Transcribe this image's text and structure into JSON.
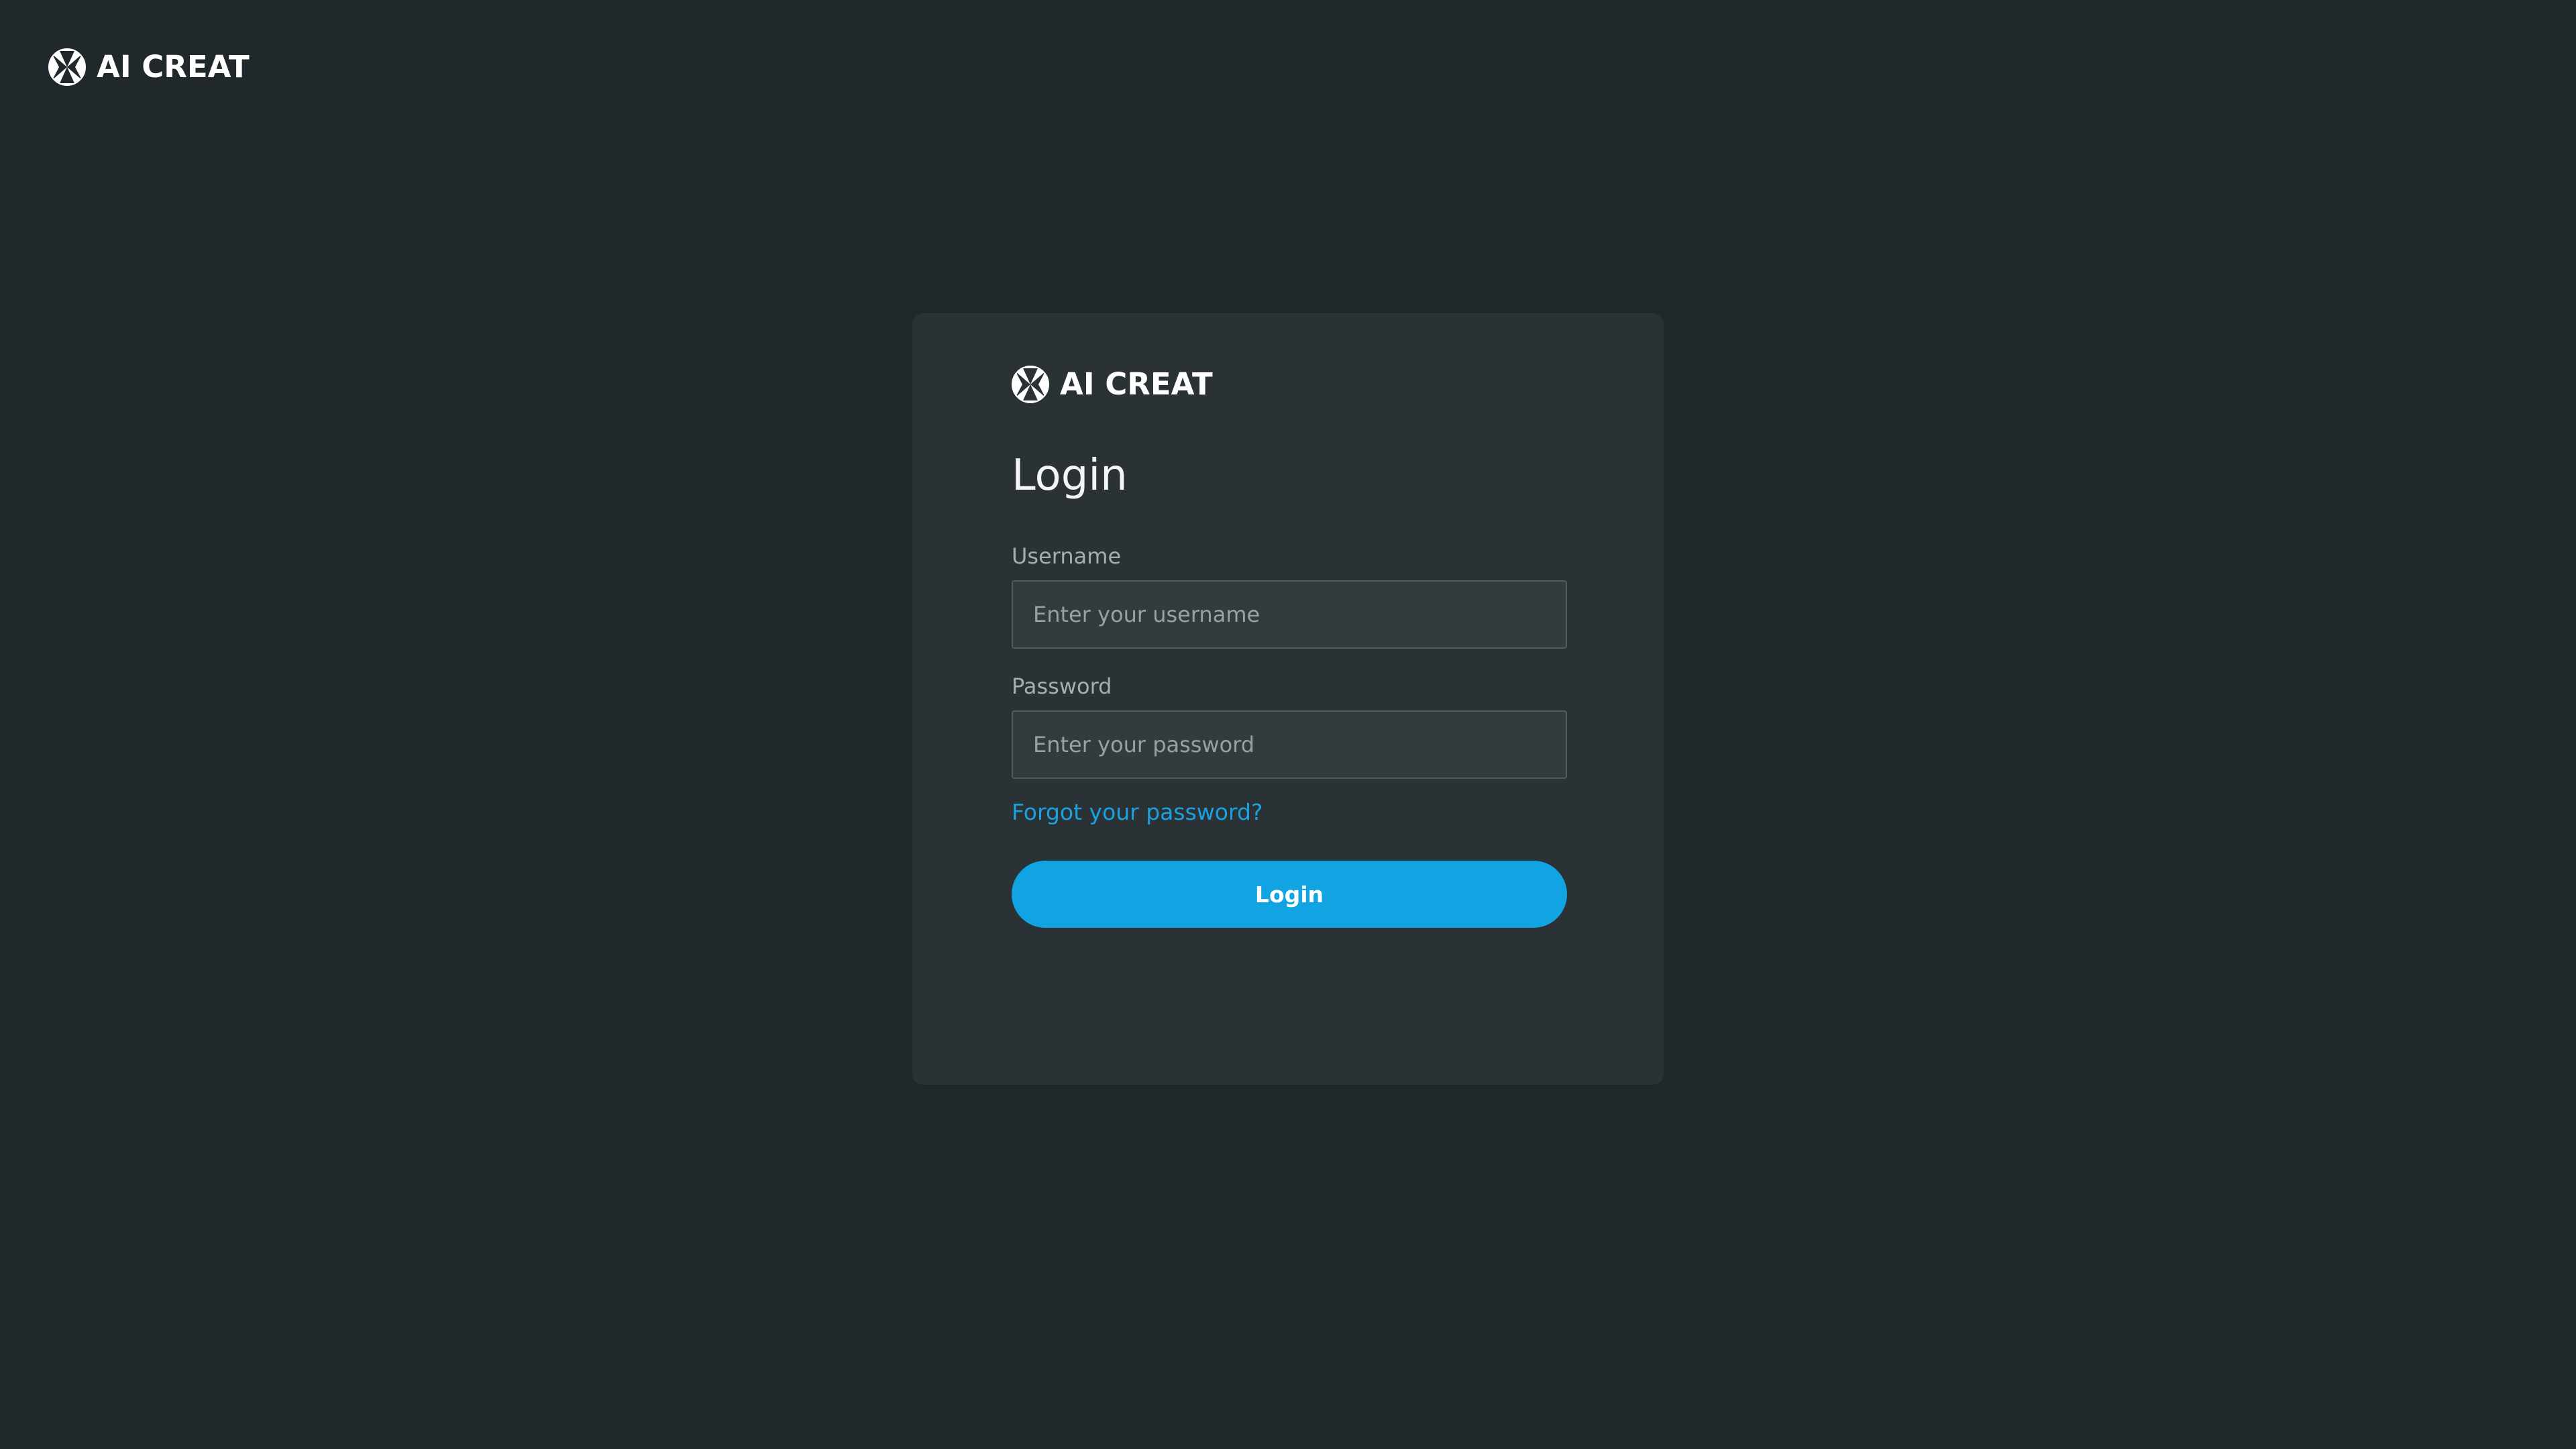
{
  "brand": {
    "name": "AI CREAT",
    "icon": "ai-creat-logo-icon"
  },
  "login_card": {
    "brand_name": "AI CREAT",
    "title": "Login",
    "username": {
      "label": "Username",
      "value": "",
      "placeholder": "Enter your username"
    },
    "password": {
      "label": "Password",
      "value": "",
      "placeholder": "Enter your password"
    },
    "forgot_link": "Forgot your password?",
    "submit_label": "Login"
  },
  "colors": {
    "page_background": "#21282c",
    "card_background": "#2b3236",
    "input_background": "#343b3e",
    "accent": "#11a3e2",
    "link": "#1aa1e0",
    "text_primary": "#ffffff",
    "text_secondary": "#a6adb1"
  }
}
